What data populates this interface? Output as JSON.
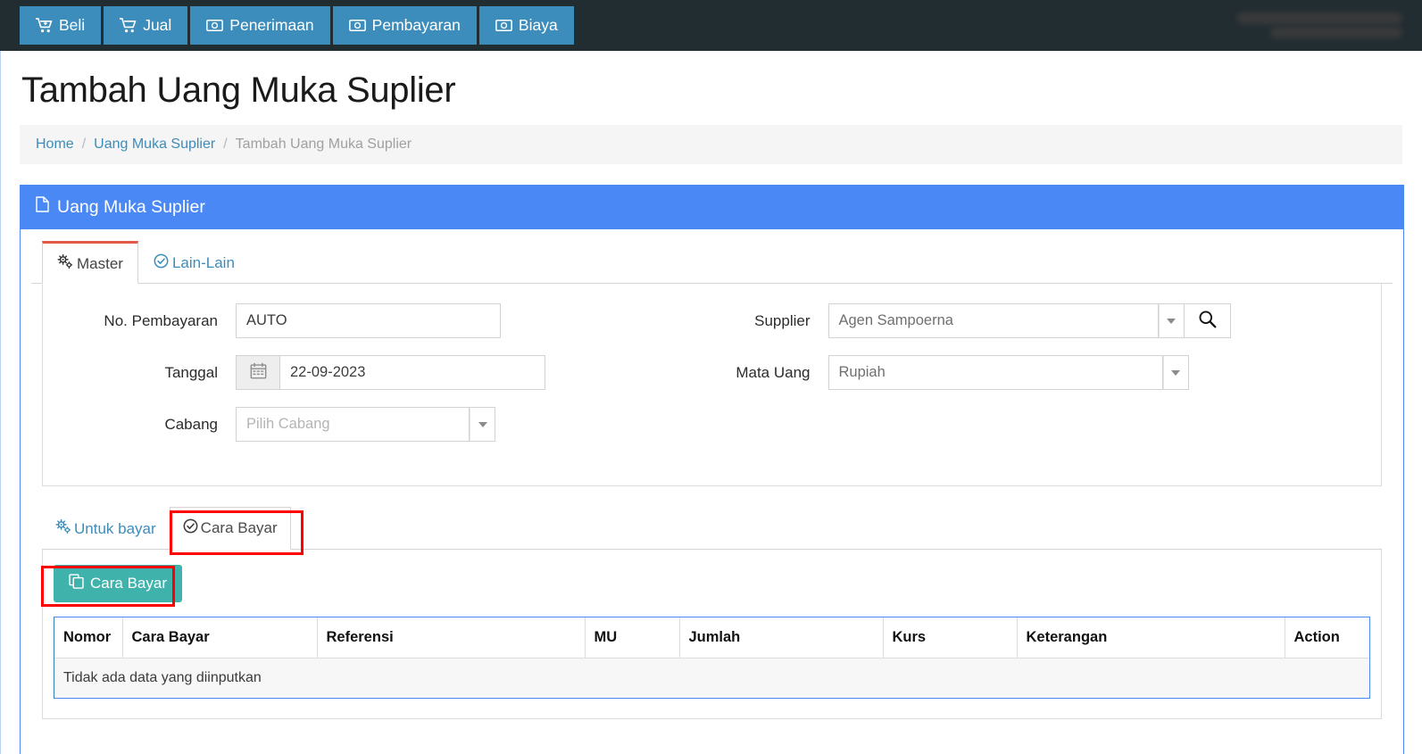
{
  "navbar": {
    "items": [
      {
        "label": "Beli",
        "icon": "cart-arrow-down-icon"
      },
      {
        "label": "Jual",
        "icon": "shopping-cart-icon"
      },
      {
        "label": "Penerimaan",
        "icon": "money-bill-icon"
      },
      {
        "label": "Pembayaran",
        "icon": "money-bill-icon"
      },
      {
        "label": "Biaya",
        "icon": "money-bill-icon"
      }
    ],
    "user_info_redacted": true
  },
  "page": {
    "title": "Tambah Uang Muka Suplier"
  },
  "breadcrumb": {
    "home": "Home",
    "parent": "Uang Muka Suplier",
    "current": "Tambah Uang Muka Suplier",
    "separator": "/"
  },
  "panel": {
    "header_title": "Uang Muka Suplier",
    "header_icon": "file-icon",
    "header_color": "#4a89f5"
  },
  "tabs": [
    {
      "label": "Master",
      "icon": "cogs-icon",
      "active": true
    },
    {
      "label": "Lain-Lain",
      "icon": "check-circle-icon",
      "active": false
    }
  ],
  "form": {
    "left": [
      {
        "label": "No. Pembayaran",
        "type": "text",
        "value": "AUTO",
        "name": "no-pembayaran-input"
      },
      {
        "label": "Tanggal",
        "type": "date",
        "value": "22-09-2023",
        "icon": "calendar-icon",
        "name": "tanggal-input"
      },
      {
        "label": "Cabang",
        "type": "select",
        "value": "",
        "placeholder": "Pilih Cabang",
        "name": "cabang-select"
      }
    ],
    "right": [
      {
        "label": "Supplier",
        "type": "select-search",
        "value": "Agen Sampoerna",
        "search_icon": "search-icon",
        "name": "supplier-select"
      },
      {
        "label": "Mata Uang",
        "type": "select",
        "value": "Rupiah",
        "name": "mata-uang-select"
      }
    ]
  },
  "lower_tabs": [
    {
      "label": "Untuk bayar",
      "icon": "cogs-icon",
      "active": false
    },
    {
      "label": "Cara Bayar",
      "icon": "check-circle-icon",
      "active": true
    }
  ],
  "cara_bayar": {
    "add_button_label": "Cara Bayar",
    "add_button_icon": "copy-icon",
    "add_button_color": "#3fb3ab",
    "table": {
      "headers": [
        "Nomor",
        "Cara Bayar",
        "Referensi",
        "MU",
        "Jumlah",
        "Kurs",
        "Keterangan",
        "Action"
      ],
      "rows": [],
      "empty_message": "Tidak ada data yang diinputkan"
    }
  },
  "annotations": {
    "highlight_color": "#fe0000",
    "boxes": [
      {
        "target": "cara-bayar-tab"
      },
      {
        "target": "cara-bayar-add-button"
      }
    ]
  }
}
